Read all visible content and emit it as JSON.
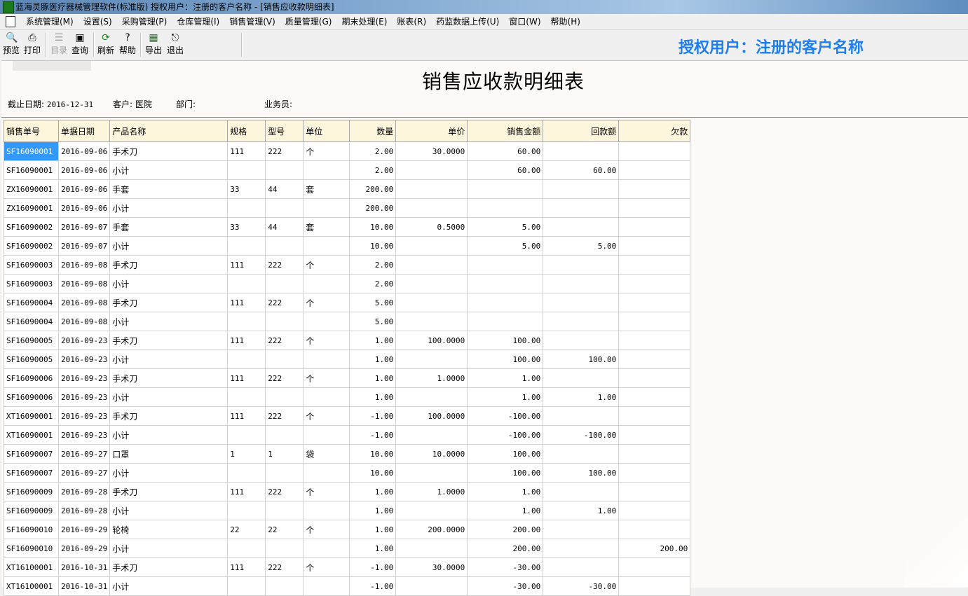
{
  "window": {
    "title": "蓝海灵豚医疗器械管理软件(标准版)     授权用户：注册的客户名称 - [销售应收款明细表]"
  },
  "menu": [
    "系统管理(M)",
    "设置(S)",
    "采购管理(P)",
    "仓库管理(I)",
    "销售管理(V)",
    "质量管理(G)",
    "期末处理(E)",
    "账表(R)",
    "药监数据上传(U)",
    "窗口(W)",
    "帮助(H)"
  ],
  "toolbar": {
    "preview": "预览",
    "print": "打印",
    "catalog": "目录",
    "query": "查询",
    "refresh": "刷新",
    "help": "帮助",
    "export": "导出",
    "exit": "退出"
  },
  "auth_banner": "授权用户：注册的客户名称",
  "report": {
    "title": "销售应收款明细表",
    "cutoff_label": "截止日期:",
    "cutoff_value": "2016-12-31",
    "customer_label": "客户:",
    "customer_value": "医院",
    "dept_label": "部门:",
    "dept_value": "",
    "salesman_label": "业务员:",
    "salesman_value": ""
  },
  "table": {
    "headers": [
      "销售单号",
      "单据日期",
      "产品名称",
      "规格",
      "型号",
      "单位",
      "数量",
      "单价",
      "销售金额",
      "回款额",
      "欠款"
    ],
    "rows": [
      [
        "SF16090001",
        "2016-09-06",
        "手术刀",
        "111",
        "222",
        "个",
        "2.00",
        "30.0000",
        "60.00",
        "",
        ""
      ],
      [
        "SF16090001",
        "2016-09-06",
        "小计",
        "",
        "",
        "",
        "2.00",
        "",
        "60.00",
        "60.00",
        ""
      ],
      [
        "ZX16090001",
        "2016-09-06",
        "手套",
        "33",
        "44",
        "套",
        "200.00",
        "",
        "",
        "",
        ""
      ],
      [
        "ZX16090001",
        "2016-09-06",
        "小计",
        "",
        "",
        "",
        "200.00",
        "",
        "",
        "",
        ""
      ],
      [
        "SF16090002",
        "2016-09-07",
        "手套",
        "33",
        "44",
        "套",
        "10.00",
        "0.5000",
        "5.00",
        "",
        ""
      ],
      [
        "SF16090002",
        "2016-09-07",
        "小计",
        "",
        "",
        "",
        "10.00",
        "",
        "5.00",
        "5.00",
        ""
      ],
      [
        "SF16090003",
        "2016-09-08",
        "手术刀",
        "111",
        "222",
        "个",
        "2.00",
        "",
        "",
        "",
        ""
      ],
      [
        "SF16090003",
        "2016-09-08",
        "小计",
        "",
        "",
        "",
        "2.00",
        "",
        "",
        "",
        ""
      ],
      [
        "SF16090004",
        "2016-09-08",
        "手术刀",
        "111",
        "222",
        "个",
        "5.00",
        "",
        "",
        "",
        ""
      ],
      [
        "SF16090004",
        "2016-09-08",
        "小计",
        "",
        "",
        "",
        "5.00",
        "",
        "",
        "",
        ""
      ],
      [
        "SF16090005",
        "2016-09-23",
        "手术刀",
        "111",
        "222",
        "个",
        "1.00",
        "100.0000",
        "100.00",
        "",
        ""
      ],
      [
        "SF16090005",
        "2016-09-23",
        "小计",
        "",
        "",
        "",
        "1.00",
        "",
        "100.00",
        "100.00",
        ""
      ],
      [
        "SF16090006",
        "2016-09-23",
        "手术刀",
        "111",
        "222",
        "个",
        "1.00",
        "1.0000",
        "1.00",
        "",
        ""
      ],
      [
        "SF16090006",
        "2016-09-23",
        "小计",
        "",
        "",
        "",
        "1.00",
        "",
        "1.00",
        "1.00",
        ""
      ],
      [
        "XT16090001",
        "2016-09-23",
        "手术刀",
        "111",
        "222",
        "个",
        "-1.00",
        "100.0000",
        "-100.00",
        "",
        ""
      ],
      [
        "XT16090001",
        "2016-09-23",
        "小计",
        "",
        "",
        "",
        "-1.00",
        "",
        "-100.00",
        "-100.00",
        ""
      ],
      [
        "SF16090007",
        "2016-09-27",
        "口罩",
        "1",
        "1",
        "袋",
        "10.00",
        "10.0000",
        "100.00",
        "",
        ""
      ],
      [
        "SF16090007",
        "2016-09-27",
        "小计",
        "",
        "",
        "",
        "10.00",
        "",
        "100.00",
        "100.00",
        ""
      ],
      [
        "SF16090009",
        "2016-09-28",
        "手术刀",
        "111",
        "222",
        "个",
        "1.00",
        "1.0000",
        "1.00",
        "",
        ""
      ],
      [
        "SF16090009",
        "2016-09-28",
        "小计",
        "",
        "",
        "",
        "1.00",
        "",
        "1.00",
        "1.00",
        ""
      ],
      [
        "SF16090010",
        "2016-09-29",
        "轮椅",
        "22",
        "22",
        "个",
        "1.00",
        "200.0000",
        "200.00",
        "",
        ""
      ],
      [
        "SF16090010",
        "2016-09-29",
        "小计",
        "",
        "",
        "",
        "1.00",
        "",
        "200.00",
        "",
        "200.00"
      ],
      [
        "XT16100001",
        "2016-10-31",
        "手术刀",
        "111",
        "222",
        "个",
        "-1.00",
        "30.0000",
        "-30.00",
        "",
        ""
      ],
      [
        "XT16100001",
        "2016-10-31",
        "小计",
        "",
        "",
        "",
        "-1.00",
        "",
        "-30.00",
        "-30.00",
        ""
      ]
    ]
  },
  "colors": {
    "auth_banner": "#1e7ef0",
    "header_bg": "#fdf5dc",
    "selected_cell": "#3399ff"
  }
}
